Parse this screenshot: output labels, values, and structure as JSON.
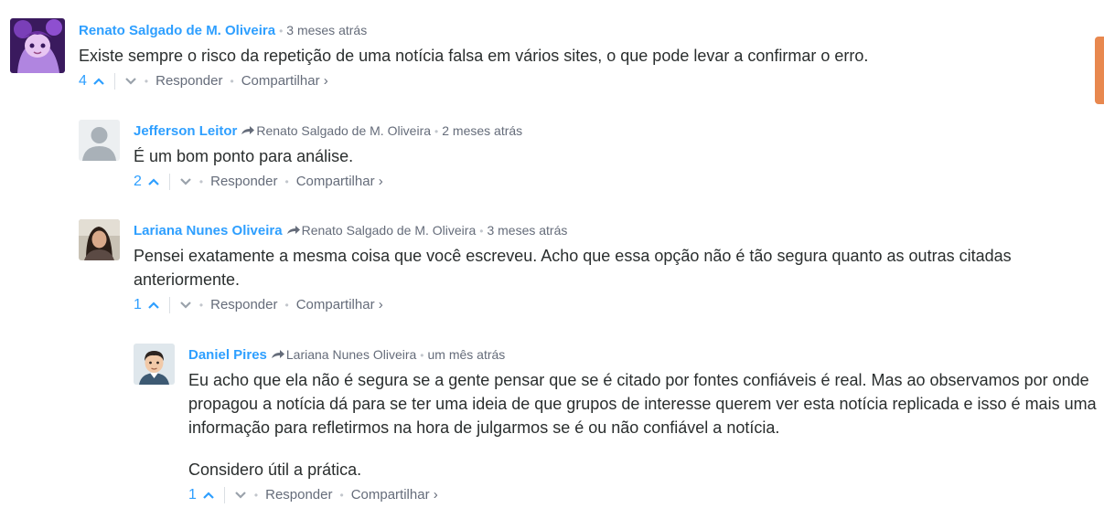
{
  "comments": [
    {
      "author": "Renato Salgado de M. Oliveira",
      "reply_to": "",
      "time": "3 meses atrás",
      "paragraphs": [
        "Existe sempre o risco da repetição de uma notícia falsa em vários sites, o que pode levar a confirmar o erro."
      ],
      "votes": "4",
      "reply_label": "Responder",
      "share_label": "Compartilhar ›",
      "avatar": "anime-character-avatar"
    },
    {
      "author": "Jefferson Leitor",
      "reply_to": "Renato Salgado de M. Oliveira",
      "time": "2 meses atrás",
      "paragraphs": [
        "É um bom ponto para análise."
      ],
      "votes": "2",
      "reply_label": "Responder",
      "share_label": "Compartilhar ›",
      "avatar": "default-user-avatar"
    },
    {
      "author": "Lariana Nunes Oliveira",
      "reply_to": "Renato Salgado de M. Oliveira",
      "time": "3 meses atrás",
      "paragraphs": [
        "Pensei exatamente a mesma coisa que você escreveu. Acho que essa opção não é tão segura quanto as outras citadas anteriormente."
      ],
      "votes": "1",
      "reply_label": "Responder",
      "share_label": "Compartilhar ›",
      "avatar": "photo-avatar"
    },
    {
      "author": "Daniel Pires",
      "reply_to": "Lariana Nunes Oliveira",
      "time": "um mês atrás",
      "paragraphs": [
        "Eu acho que ela não é segura se a gente pensar que se é citado por fontes confiáveis é real. Mas ao observamos por onde propagou a notícia dá para se ter uma ideia de que grupos de interesse querem ver esta notícia replicada e isso é mais uma informação para refletirmos na hora de julgarmos se é ou não confiável a notícia.",
        "Considero útil a prática."
      ],
      "votes": "1",
      "reply_label": "Responder",
      "share_label": "Compartilhar ›",
      "avatar": "cartoon-man-avatar"
    }
  ],
  "colors": {
    "author": "#2e9fff",
    "meta": "#656c7a",
    "text": "#2a2e2e",
    "side_tab": "#e8884f"
  }
}
